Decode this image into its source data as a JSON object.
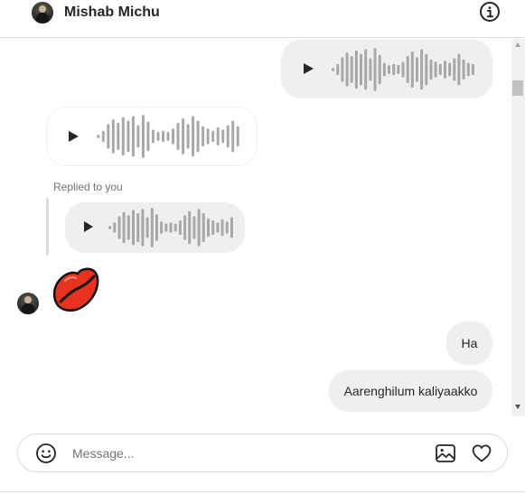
{
  "header": {
    "contact_name": "Mishab Michu",
    "avatar_icon": "profile-photo",
    "info_icon": "info-circle-icon"
  },
  "messages": [
    {
      "type": "voice",
      "sender": "me"
    },
    {
      "type": "voice",
      "sender": "them"
    },
    {
      "type": "voice",
      "sender": "them",
      "reply_label": "Replied to you"
    },
    {
      "type": "emoji",
      "sender": "them",
      "icon": "kiss-mark-icon"
    },
    {
      "type": "text",
      "sender": "me",
      "text": "Ha"
    },
    {
      "type": "text",
      "sender": "me",
      "text": "Aarenghilum kaliyaakko"
    }
  ],
  "reply_label": "Replied to you",
  "bubbles": {
    "ha": "Ha",
    "aarenghilum": "Aarenghilum kaliyaakko"
  },
  "composer": {
    "placeholder": "Message...",
    "emoji_icon": "smiley-icon",
    "image_icon": "image-icon",
    "like_icon": "heart-icon"
  },
  "colors": {
    "bubble_gray": "#efefef",
    "text": "#262626",
    "secondary_text": "#737373",
    "waveform": "#a8a8a8",
    "lips_red": "#e8321f"
  }
}
